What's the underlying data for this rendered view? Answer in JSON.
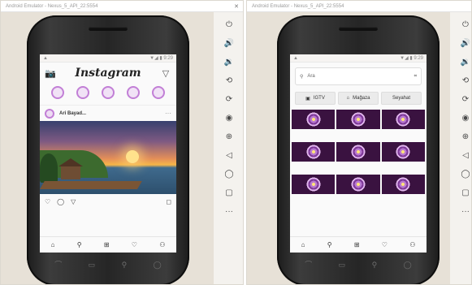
{
  "window1": {
    "title": "Android Emulator - Nexus_5_API_22:5554",
    "close": "✕",
    "screen": {
      "status": {
        "left": "▲",
        "right": "▼◢ ▮ 9:29"
      },
      "header": {
        "camera_icon": "📷",
        "logo": "Instagram",
        "direct_icon": "▽"
      },
      "stories_count": 5,
      "post": {
        "username": "Ari Bayad...",
        "more": "···"
      },
      "actions": {
        "like": "♡",
        "comment": "◯",
        "share": "▽",
        "save": "◻"
      },
      "bottom_nav": {
        "home": "⌂",
        "search": "⚲",
        "add": "⊞",
        "heart": "♡",
        "profile": "⚇"
      }
    }
  },
  "window2": {
    "title": "Android Emulator - Nexus_5_API_22:5554",
    "screen": {
      "status": {
        "left": "▲",
        "right": "▼◢ ▮ 9:29"
      },
      "search": {
        "icon": "⚲",
        "query": "Ara",
        "scan_icon": "⌗"
      },
      "chips": [
        {
          "icon": "▣",
          "label": "IGTV"
        },
        {
          "icon": "⌂",
          "label": "Mağaza"
        },
        {
          "icon": "",
          "label": "Seyahat"
        }
      ],
      "bottom_nav": {
        "home": "⌂",
        "search": "⚲",
        "add": "⊞",
        "heart": "♡",
        "profile": "⚇"
      }
    }
  },
  "phone_nav": {
    "back": "⌒",
    "home": "▭",
    "search": "⚲",
    "recent": "◯"
  },
  "emulator_panel": {
    "power": "⏻",
    "volume_up": "🔊",
    "volume_down": "🔉",
    "rotate_left": "⟲",
    "rotate_right": "⟳",
    "screenshot": "◉",
    "zoom": "⊕",
    "back": "◁",
    "home": "◯",
    "overview": "▢",
    "more": "···"
  }
}
